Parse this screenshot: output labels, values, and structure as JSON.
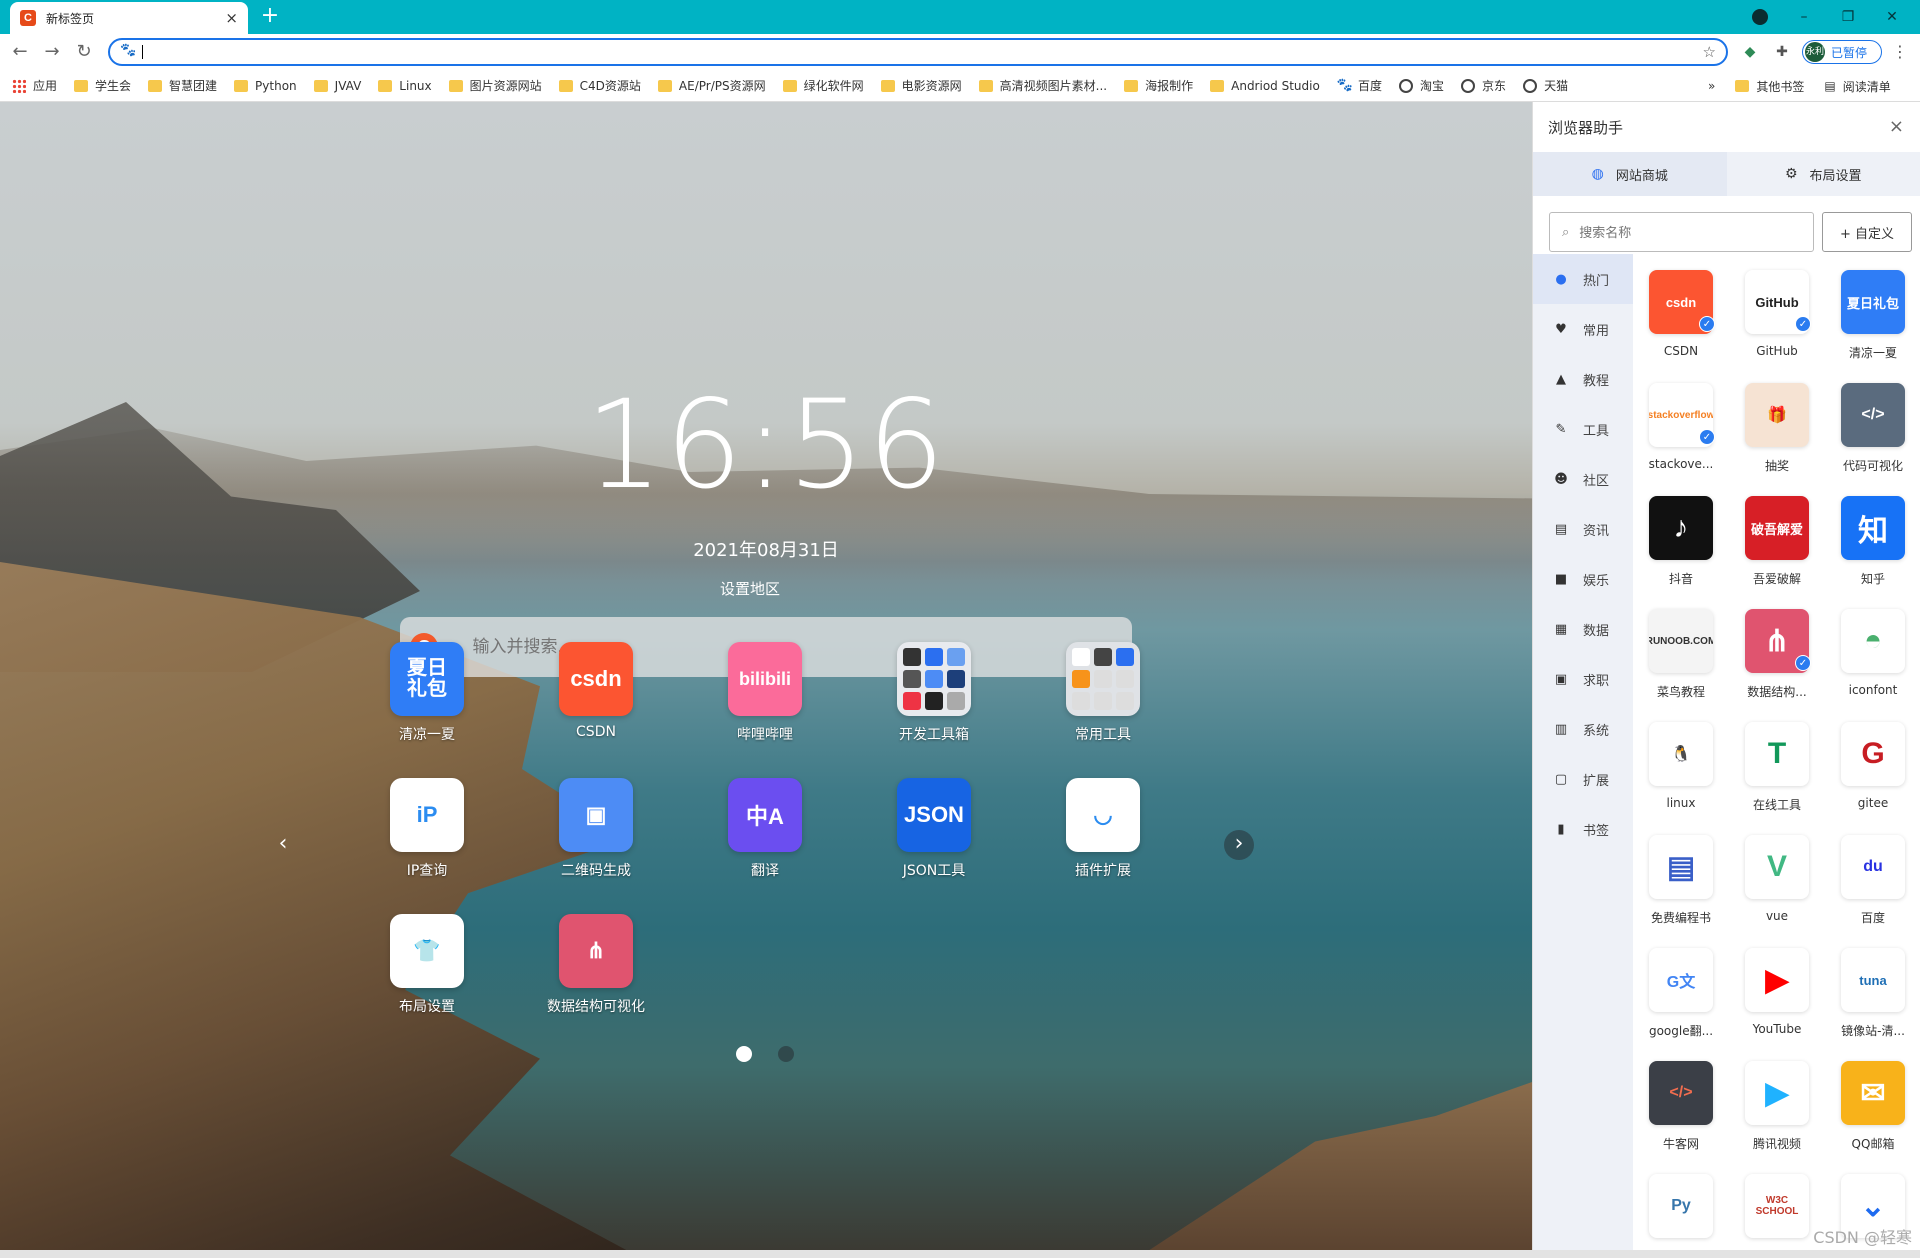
{
  "tab": {
    "favicon": "C",
    "title": "新标签页",
    "close": "×",
    "new": "+"
  },
  "window": {
    "minimize": "–",
    "restore": "❐",
    "close": "✕"
  },
  "address": {
    "value": "",
    "paused_avatar": "永利",
    "paused_label": "已暂停"
  },
  "bookmarks": {
    "items": [
      {
        "label": "应用",
        "icon": "apps-icon"
      },
      {
        "label": "学生会",
        "icon": "folder-icon"
      },
      {
        "label": "智慧团建",
        "icon": "folder-icon"
      },
      {
        "label": "Python",
        "icon": "folder-icon"
      },
      {
        "label": "JVAV",
        "icon": "folder-icon"
      },
      {
        "label": "Linux",
        "icon": "folder-icon"
      },
      {
        "label": "图片资源网站",
        "icon": "folder-icon"
      },
      {
        "label": "C4D资源站",
        "icon": "folder-icon"
      },
      {
        "label": "AE/Pr/PS资源网",
        "icon": "folder-icon"
      },
      {
        "label": "绿化软件网",
        "icon": "folder-icon"
      },
      {
        "label": "电影资源网",
        "icon": "folder-icon"
      },
      {
        "label": "高清视频图片素材...",
        "icon": "folder-icon"
      },
      {
        "label": "海报制作",
        "icon": "folder-icon"
      },
      {
        "label": "Andriod Studio",
        "icon": "folder-icon"
      },
      {
        "label": "百度",
        "icon": "paw-icon"
      },
      {
        "label": "淘宝",
        "icon": "globe-icon"
      },
      {
        "label": "京东",
        "icon": "globe-icon"
      },
      {
        "label": "天猫",
        "icon": "globe-icon"
      }
    ],
    "overflow": "»",
    "other": "其他书签",
    "reading": "阅读清单"
  },
  "newtab": {
    "time": "16:56",
    "date": "2021年08月31日",
    "region": "设置地区",
    "search_placeholder": "输入并搜索...",
    "search_logo": "C",
    "apps": [
      {
        "label": "清凉一夏",
        "text": "夏日\n礼包",
        "bg": "#2f7df6"
      },
      {
        "label": "CSDN",
        "text": "csdn",
        "bg": "#fc5531"
      },
      {
        "label": "哔哩哔哩",
        "text": "bilibili",
        "bg": "#fb6b9a"
      },
      {
        "label": "开发工具箱",
        "text": "",
        "bg": "#e8eaee"
      },
      {
        "label": "常用工具",
        "text": "",
        "bg": "#dfe2e6"
      },
      {
        "label": "IP查询",
        "text": "iP",
        "bg": "#ffffff"
      },
      {
        "label": "二维码生成",
        "text": "▣",
        "bg": "#4d8cf5"
      },
      {
        "label": "翻译",
        "text": "中A",
        "bg": "#6b4ef0"
      },
      {
        "label": "JSON工具",
        "text": "JSON",
        "bg": "#1764e3"
      },
      {
        "label": "插件扩展",
        "text": "◡",
        "bg": "#ffffff"
      },
      {
        "label": "布局设置",
        "text": "👕",
        "bg": "#ffffff"
      },
      {
        "label": "数据结构可视化",
        "text": "⋔",
        "bg": "#e0546f"
      }
    ],
    "prev": "‹",
    "next": "›"
  },
  "panel": {
    "title": "浏览器助手",
    "close": "×",
    "tabs": [
      {
        "label": "网站商城",
        "icon": "globe-icon"
      },
      {
        "label": "布局设置",
        "icon": "gear-icon"
      }
    ],
    "search_placeholder": "搜索名称",
    "custom": "+ 自定义",
    "categories": [
      {
        "label": "热门",
        "icon": "fire-icon",
        "glyph": "●"
      },
      {
        "label": "常用",
        "icon": "heart-icon",
        "glyph": "♥"
      },
      {
        "label": "教程",
        "icon": "user-icon",
        "glyph": "▲"
      },
      {
        "label": "工具",
        "icon": "wrench-icon",
        "glyph": "✎"
      },
      {
        "label": "社区",
        "icon": "community-icon",
        "glyph": "☻"
      },
      {
        "label": "资讯",
        "icon": "news-icon",
        "glyph": "▤"
      },
      {
        "label": "娱乐",
        "icon": "video-icon",
        "glyph": "■"
      },
      {
        "label": "数据",
        "icon": "data-icon",
        "glyph": "▦"
      },
      {
        "label": "求职",
        "icon": "job-icon",
        "glyph": "▣"
      },
      {
        "label": "系统",
        "icon": "system-icon",
        "glyph": "▥"
      },
      {
        "label": "扩展",
        "icon": "extension-icon",
        "glyph": "▢"
      },
      {
        "label": "书签",
        "icon": "bookmark-icon",
        "glyph": "▮"
      }
    ],
    "sites": [
      {
        "label": "CSDN",
        "text": "csdn",
        "bg": "#fc5531",
        "fg": "#fff",
        "check": true
      },
      {
        "label": "GitHub",
        "text": "GitHub",
        "bg": "#ffffff",
        "fg": "#222",
        "check": true
      },
      {
        "label": "清凉一夏",
        "text": "夏日礼包",
        "bg": "#2f7df6",
        "fg": "#fff",
        "check": false
      },
      {
        "label": "stackove...",
        "text": "stackoverflow",
        "bg": "#ffffff",
        "fg": "#f48024",
        "check": true
      },
      {
        "label": "抽奖",
        "text": "🎁",
        "bg": "#f6e3d3",
        "fg": "#e55",
        "check": false
      },
      {
        "label": "代码可视化",
        "text": "</>",
        "bg": "#5a6b7e",
        "fg": "#fff",
        "check": false
      },
      {
        "label": "抖音",
        "text": "♪",
        "bg": "#111111",
        "fg": "#fff",
        "check": false
      },
      {
        "label": "吾爱破解",
        "text": "破吾解爱",
        "bg": "#d71f26",
        "fg": "#fff",
        "check": false
      },
      {
        "label": "知乎",
        "text": "知",
        "bg": "#1772f6",
        "fg": "#fff",
        "check": false
      },
      {
        "label": "菜鸟教程",
        "text": "RUNOOB.COM",
        "bg": "#f4f4f4",
        "fg": "#333",
        "check": false
      },
      {
        "label": "数据结构...",
        "text": "⋔",
        "bg": "#e0546f",
        "fg": "#fff",
        "check": true
      },
      {
        "label": "iconfont",
        "text": "◓",
        "bg": "#ffffff",
        "fg": "#4ab06e",
        "check": false
      },
      {
        "label": "linux",
        "text": "🐧",
        "bg": "#ffffff",
        "fg": "#000",
        "check": false
      },
      {
        "label": "在线工具",
        "text": "T",
        "bg": "#ffffff",
        "fg": "#12985a",
        "check": false
      },
      {
        "label": "gitee",
        "text": "G",
        "bg": "#ffffff",
        "fg": "#c71d23",
        "check": false
      },
      {
        "label": "免费编程书",
        "text": "▤",
        "bg": "#ffffff",
        "fg": "#3a5fc8",
        "check": false
      },
      {
        "label": "vue",
        "text": "V",
        "bg": "#ffffff",
        "fg": "#41b883",
        "check": false
      },
      {
        "label": "百度",
        "text": "du",
        "bg": "#ffffff",
        "fg": "#2932e1",
        "check": false
      },
      {
        "label": "google翻...",
        "text": "G文",
        "bg": "#ffffff",
        "fg": "#4285f4",
        "check": false
      },
      {
        "label": "YouTube",
        "text": "▶",
        "bg": "#ffffff",
        "fg": "#ff0000",
        "check": false
      },
      {
        "label": "镜像站-清...",
        "text": "tuna",
        "bg": "#ffffff",
        "fg": "#1f6fb5",
        "check": false
      },
      {
        "label": "牛客网",
        "text": "</>",
        "bg": "#3b3f47",
        "fg": "#f26d4f",
        "check": false
      },
      {
        "label": "腾讯视频",
        "text": "▶",
        "bg": "#ffffff",
        "fg": "#1fb2ff",
        "check": false
      },
      {
        "label": "QQ邮箱",
        "text": "✉",
        "bg": "#f8b21a",
        "fg": "#fff",
        "check": false
      },
      {
        "label": "",
        "text": "Py",
        "bg": "#ffffff",
        "fg": "#3776ab",
        "check": false
      },
      {
        "label": "",
        "text": "W3C SCHOOL",
        "bg": "#ffffff",
        "fg": "#c0392b",
        "check": false
      },
      {
        "label": "",
        "text": "⌄",
        "bg": "#ffffff",
        "fg": "#1e6bf0",
        "check": false
      }
    ],
    "watermark": "CSDN @轻寒"
  }
}
